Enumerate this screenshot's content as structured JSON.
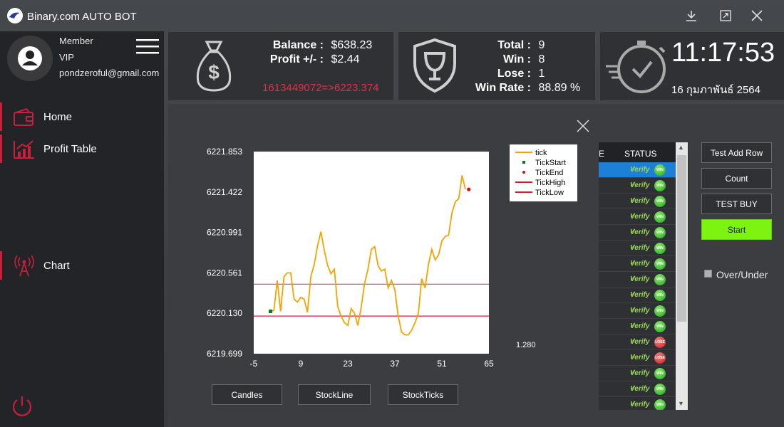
{
  "app": {
    "title": "Binary.com AUTO BOT"
  },
  "window_buttons": [
    "download-icon",
    "maximize-icon",
    "close-icon"
  ],
  "user": {
    "role": "Member",
    "level": "VIP",
    "email": "pondzeroful@gmail.com"
  },
  "nav": [
    {
      "label": "Home",
      "icon": "wallet-icon"
    },
    {
      "label": "Profit Table",
      "icon": "chart-growth-icon"
    },
    {
      "label": "Chart",
      "icon": "signal-tower-icon"
    }
  ],
  "balance_card": {
    "balance_label": "Balance :",
    "balance_value": "$638.23",
    "profit_label": "Profit +/- :",
    "profit_value": "$2.44",
    "contract_info": "1613449072=>6223.374"
  },
  "stats_card": {
    "total_label": "Total :",
    "total_value": "9",
    "win_label": "Win :",
    "win_value": "8",
    "lose_label": "Lose :",
    "lose_value": "1",
    "winrate_label": "Win Rate :",
    "winrate_value": "88.89 %"
  },
  "clock_card": {
    "time": "11:17:53",
    "date": "16 กุมภาพันธ์ 2564"
  },
  "chart_buttons": [
    "Candles",
    "StockLine",
    "StockTicks"
  ],
  "ratio_text": "1.280",
  "table": {
    "col_e": "E",
    "col_status": "STATUS",
    "verify_text": "Verify",
    "rows": [
      "WIN",
      "WIN",
      "WIN",
      "WIN",
      "WIN",
      "WIN",
      "WIN",
      "WIN",
      "WIN",
      "WIN",
      "WIN",
      "LOSE",
      "LOSE",
      "WIN",
      "WIN",
      "WIN"
    ]
  },
  "side_buttons": {
    "test_add_row": "Test Add Row",
    "count": "Count",
    "test_buy": "TEST BUY",
    "start": "Start"
  },
  "overunder": {
    "label": "Over/Under",
    "checked": true
  },
  "colors": {
    "accent_red": "#c8203a",
    "tick_line": "#f5a300",
    "tick_high": "#c8203a",
    "start_green": "#7cf410"
  },
  "chart_data": {
    "type": "line",
    "xlim": [
      -5,
      65
    ],
    "ylim": [
      6219.699,
      6221.853
    ],
    "xticks": [
      -5,
      9,
      23,
      37,
      51,
      65
    ],
    "yticks": [
      6219.699,
      6220.13,
      6220.561,
      6220.991,
      6221.422,
      6221.853
    ],
    "ytick_labels": [
      "6219.699",
      "6220.130",
      "6220.561",
      "6220.991",
      "6221.422",
      "6221.853"
    ],
    "legend": [
      "tick",
      "TickStart",
      "TickEnd",
      "TickHigh",
      "TickLow"
    ],
    "legend_position": "top-right",
    "series": [
      {
        "name": "tick",
        "x": [
          0,
          1,
          2,
          3,
          4,
          5,
          6,
          7,
          8,
          9,
          10,
          11,
          12,
          13,
          14,
          15,
          16,
          17,
          18,
          19,
          20,
          21,
          22,
          23,
          24,
          25,
          26,
          27,
          28,
          29,
          30,
          31,
          32,
          33,
          34,
          35,
          36,
          37,
          38,
          39,
          40,
          41,
          42,
          43,
          44,
          45,
          46,
          47,
          48,
          49,
          50,
          51,
          52,
          53,
          54,
          55,
          56,
          57,
          58
        ],
        "values": [
          6220.15,
          6220.16,
          6220.48,
          6220.15,
          6220.52,
          6220.56,
          6220.56,
          6220.28,
          6220.25,
          6220.3,
          6220.28,
          6220.14,
          6220.52,
          6220.65,
          6220.85,
          6221.0,
          6220.8,
          6220.64,
          6220.55,
          6220.6,
          6220.2,
          6220.1,
          6220.03,
          6220.0,
          6220.18,
          6220.13,
          6220.0,
          6220.2,
          6220.45,
          6220.6,
          6220.81,
          6220.84,
          6220.64,
          6220.58,
          6220.6,
          6220.4,
          6220.48,
          6220.38,
          6220.1,
          6219.93,
          6219.9,
          6219.9,
          6219.95,
          6220.03,
          6220.13,
          6220.5,
          6220.4,
          6220.65,
          6220.81,
          6220.7,
          6220.75,
          6220.9,
          6220.95,
          6220.96,
          6221.2,
          6221.32,
          6221.35,
          6221.6,
          6221.45
        ]
      },
      {
        "name": "TickStart",
        "x": [
          0
        ],
        "values": [
          6220.15
        ]
      },
      {
        "name": "TickEnd",
        "x": [
          59
        ],
        "values": [
          6221.45
        ]
      },
      {
        "name": "TickHigh",
        "x": [
          -5,
          65
        ],
        "values": [
          6220.44,
          6220.44
        ]
      },
      {
        "name": "TickLow",
        "x": [
          -5,
          65
        ],
        "values": [
          6220.1,
          6220.1
        ]
      }
    ]
  }
}
